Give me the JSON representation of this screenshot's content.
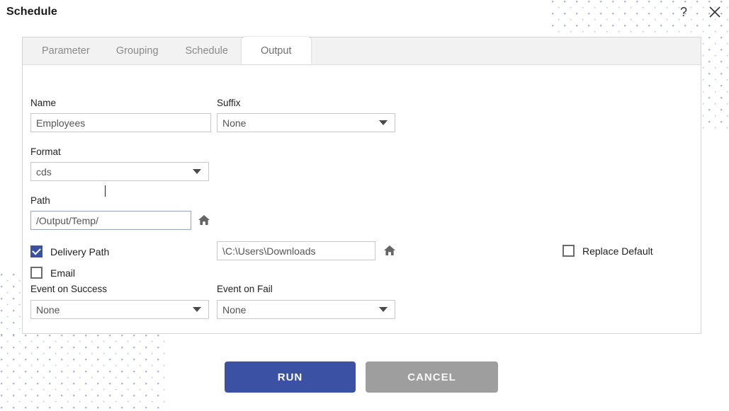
{
  "window": {
    "title": "Schedule",
    "help_icon": "question-mark-icon",
    "close_icon": "close-x-icon"
  },
  "tabs": [
    {
      "label": "Parameter",
      "active": false
    },
    {
      "label": "Grouping",
      "active": false
    },
    {
      "label": "Schedule",
      "active": false
    },
    {
      "label": "Output",
      "active": true
    }
  ],
  "form": {
    "name": {
      "label": "Name",
      "value": "Employees"
    },
    "suffix": {
      "label": "Suffix",
      "value": "None",
      "options": [
        "None"
      ]
    },
    "format": {
      "label": "Format",
      "value": "cds",
      "options": [
        "cds"
      ]
    },
    "path": {
      "label": "Path",
      "value": "/Output/Temp/",
      "home_icon": "home-icon"
    },
    "delivery_path": {
      "label": "Delivery Path",
      "checked": true,
      "value": "\\C:\\Users\\Downloads",
      "home_icon": "home-icon"
    },
    "email": {
      "label": "Email",
      "checked": false
    },
    "replace_default": {
      "label": "Replace Default",
      "checked": false
    },
    "event_on_success": {
      "label": "Event on Success",
      "value": "None",
      "options": [
        "None"
      ]
    },
    "event_on_fail": {
      "label": "Event on Fail",
      "value": "None",
      "options": [
        "None"
      ]
    }
  },
  "footer": {
    "run_label": "RUN",
    "cancel_label": "CANCEL"
  },
  "colors": {
    "accent": "#3a51a4",
    "cancel": "#9e9e9e",
    "dots": "#aab4e4",
    "tab_bar": "#f2f2f2"
  }
}
